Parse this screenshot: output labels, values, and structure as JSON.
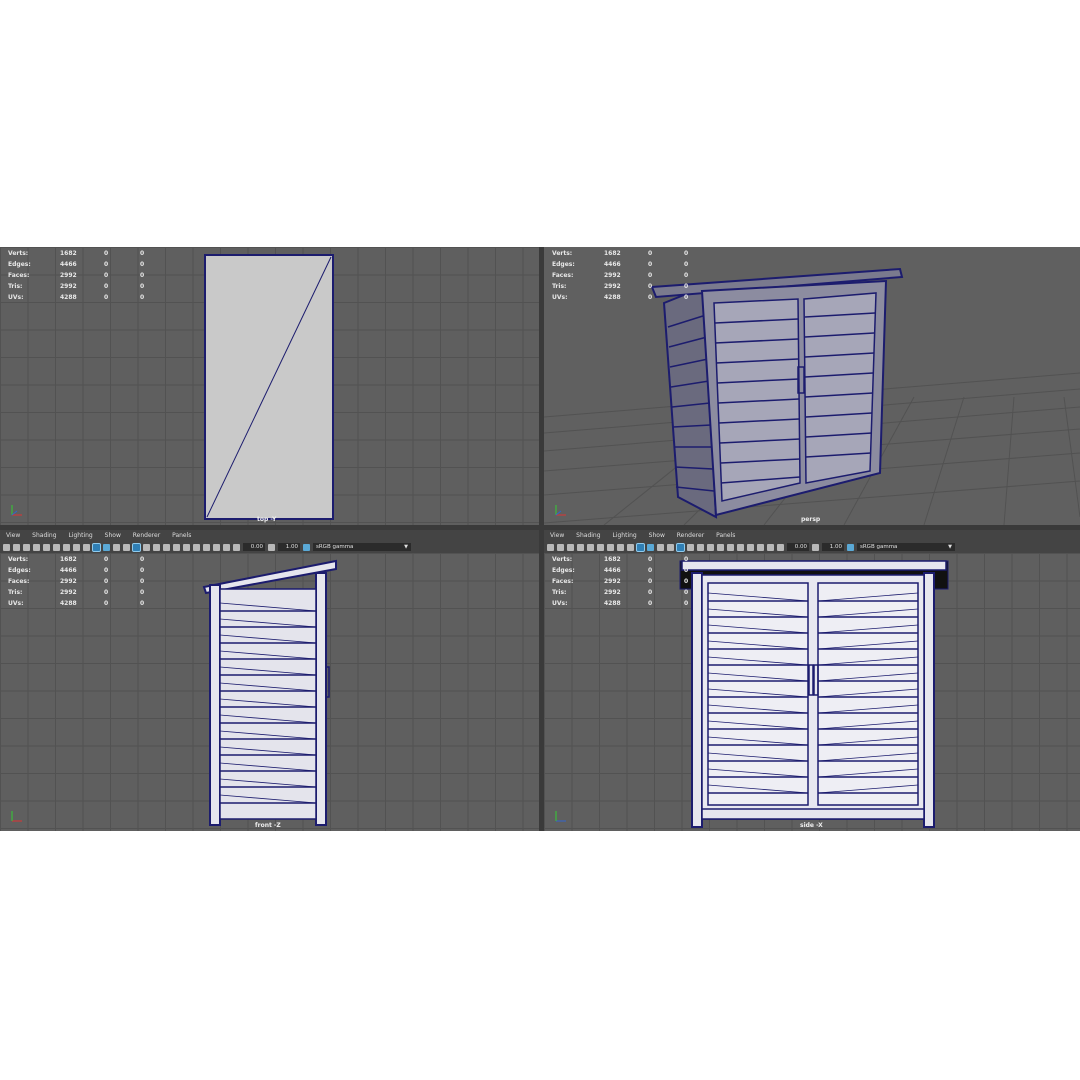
{
  "stats": {
    "rows": [
      {
        "label": "Verts:",
        "v1": "1682",
        "v2": "0",
        "v3": "0"
      },
      {
        "label": "Edges:",
        "v1": "4466",
        "v2": "0",
        "v3": "0"
      },
      {
        "label": "Faces:",
        "v1": "2992",
        "v2": "0",
        "v3": "0"
      },
      {
        "label": "Tris:",
        "v1": "2992",
        "v2": "0",
        "v3": "0"
      },
      {
        "label": "UVs:",
        "v1": "4288",
        "v2": "0",
        "v3": "0"
      }
    ]
  },
  "cameras": {
    "top": "top -Y",
    "persp": "persp",
    "front": "front -Z",
    "side": "side -X"
  },
  "menu": {
    "view": "View",
    "shading": "Shading",
    "lighting": "Lighting",
    "show": "Show",
    "renderer": "Renderer",
    "panels": "Panels"
  },
  "toolbar": {
    "exposure": "0.00",
    "gamma": "1.00",
    "colorspace": "sRGB gamma"
  },
  "colors": {
    "viewport_bg": "#5f5f5f",
    "grid": "#525252",
    "wire": "#1c1c6e",
    "model_fill": "#c8c8c8"
  }
}
